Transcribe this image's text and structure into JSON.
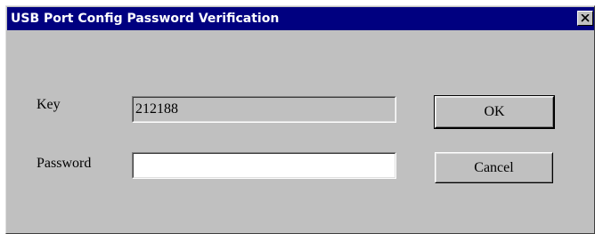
{
  "window": {
    "title": "USB Port Config Password Verification",
    "close_icon": "close-icon"
  },
  "form": {
    "key_label": "Key",
    "key_value": "212188",
    "password_label": "Password",
    "password_value": ""
  },
  "buttons": {
    "ok_label": "OK",
    "cancel_label": "Cancel"
  },
  "colors": {
    "titlebar": "#000080",
    "dialog_face": "#c0c0c0"
  }
}
